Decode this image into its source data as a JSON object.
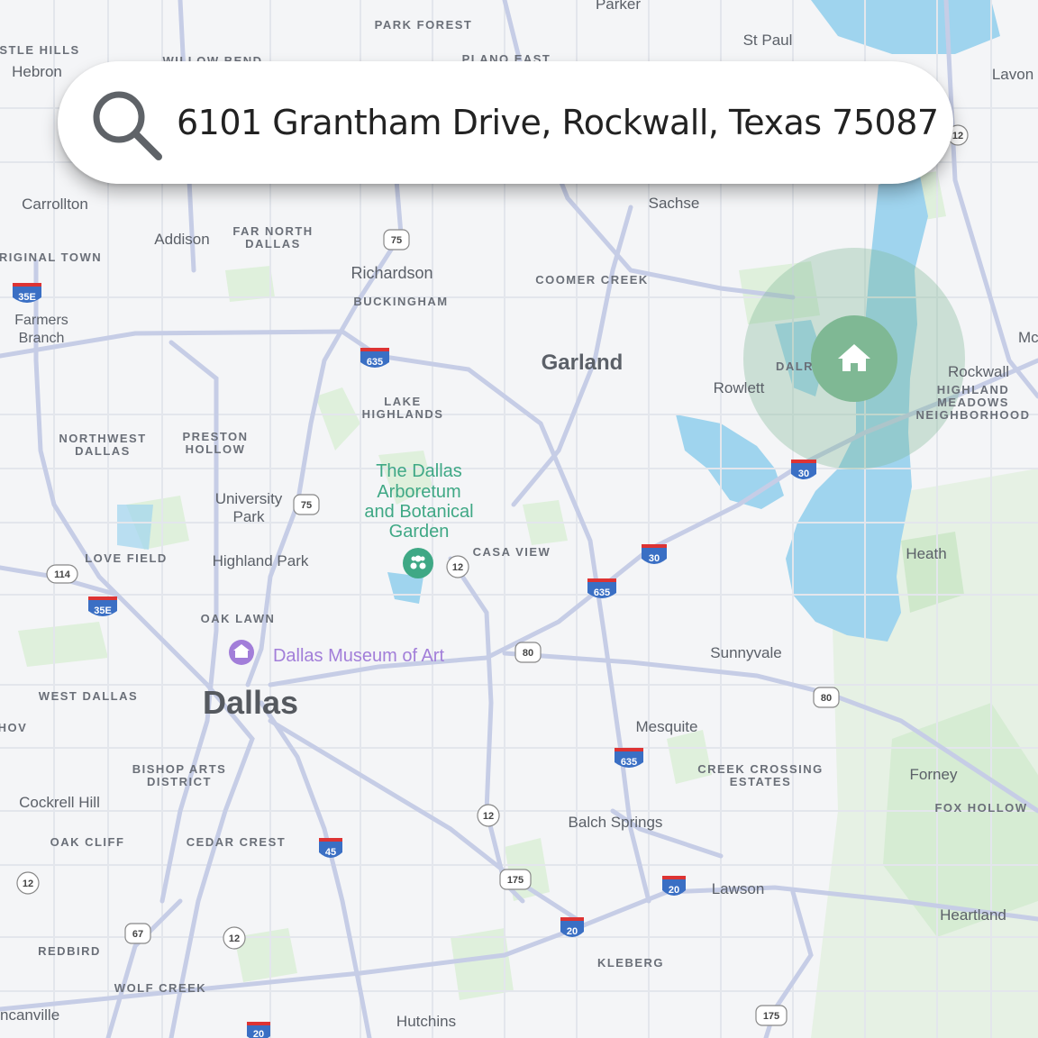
{
  "search": {
    "query": "6101 Grantham Drive, Rockwall, Texas 75087"
  },
  "colors": {
    "water": "#9fd4ee",
    "park": "#dff0dc",
    "road": "#c6cde6",
    "highlight": "#7fb894",
    "label": "#5b6068"
  },
  "icons": {
    "search": "search-icon",
    "home": "home-icon",
    "garden": "garden-icon",
    "museum": "museum-icon"
  },
  "labels": {
    "dallas": "Dallas",
    "garland": "Garland",
    "richardson": "Richardson",
    "rowlett": "Rowlett",
    "rockwall": "Rockwall",
    "mesquite": "Mesquite",
    "sunnyvale": "Sunnyvale",
    "heath": "Heath",
    "forney": "Forney",
    "heartland": "Heartland",
    "balch_springs": "Balch Springs",
    "lawson": "Lawson",
    "hutchins": "Hutchins",
    "cockrell_hill": "Cockrell Hill",
    "highland_park": "Highland Park",
    "university_park_1": "University",
    "university_park_2": "Park",
    "addison": "Addison",
    "carrollton": "Carrollton",
    "farmers_branch_1": "Farmers",
    "farmers_branch_2": "Branch",
    "hebron": "Hebron",
    "sachse": "Sachse",
    "st_paul": "St Paul",
    "parker": "Parker",
    "lavon": "Lavon",
    "mc": "Mc",
    "lancaster_partial": "ncanville",
    "castle_hills": "STLE HILLS",
    "park_forest": "PARK FOREST",
    "willow_bend": "WILLOW BEND",
    "plano_east": "PLANO EAST",
    "far_north_dallas_1": "FAR NORTH",
    "far_north_dallas_2": "DALLAS",
    "original_town": "RIGINAL TOWN",
    "buckingham": "BUCKINGHAM",
    "coomer_creek": "COOMER CREEK",
    "lake_highlands_1": "LAKE",
    "lake_highlands_2": "HIGHLANDS",
    "northwest_dallas_1": "NORTHWEST",
    "northwest_dallas_2": "DALLAS",
    "preston_hollow_1": "PRESTON",
    "preston_hollow_2": "HOLLOW",
    "love_field": "LOVE FIELD",
    "casa_view": "CASA VIEW",
    "oak_lawn": "OAK LAWN",
    "west_dallas": "WEST DALLAS",
    "bishop_arts_1": "BISHOP ARTS",
    "bishop_arts_2": "DISTRICT",
    "oak_cliff": "OAK CLIFF",
    "cedar_crest": "CEDAR CREST",
    "redbird": "REDBIRD",
    "wolf_creek": "WOLF CREEK",
    "kleberg": "KLEBERG",
    "creek_crossing_1": "CREEK CROSSING",
    "creek_crossing_2": "ESTATES",
    "fox_hollow": "FOX HOLLOW",
    "highland_meadows_1": "HIGHLAND",
    "highland_meadows_2": "MEADOWS",
    "highland_meadows_3": "NEIGHBORHOOD",
    "dalr": "DALR",
    "hov": "HOV",
    "arboretum_1": "The Dallas",
    "arboretum_2": "Arboretum",
    "arboretum_3": "and Botanical",
    "arboretum_4": "Garden",
    "museum": "Dallas Museum of Art"
  },
  "shields": {
    "i635_a": "635",
    "i635_b": "635",
    "i635_c": "635",
    "i30_a": "30",
    "i30_b": "30",
    "i35e_a": "35E",
    "i35e_b": "35E",
    "i45": "45",
    "i20_a": "20",
    "i20_b": "20",
    "i20_c": "20",
    "us75_a": "75",
    "us75_b": "75",
    "us80_a": "80",
    "us80_b": "80",
    "sh12_a": "12",
    "sh12_b": "12",
    "sh12_c": "12",
    "sh12_d": "12",
    "us175_a": "175",
    "us175_b": "175",
    "us67": "67",
    "sh114": "114",
    "sh12_e": "12"
  }
}
